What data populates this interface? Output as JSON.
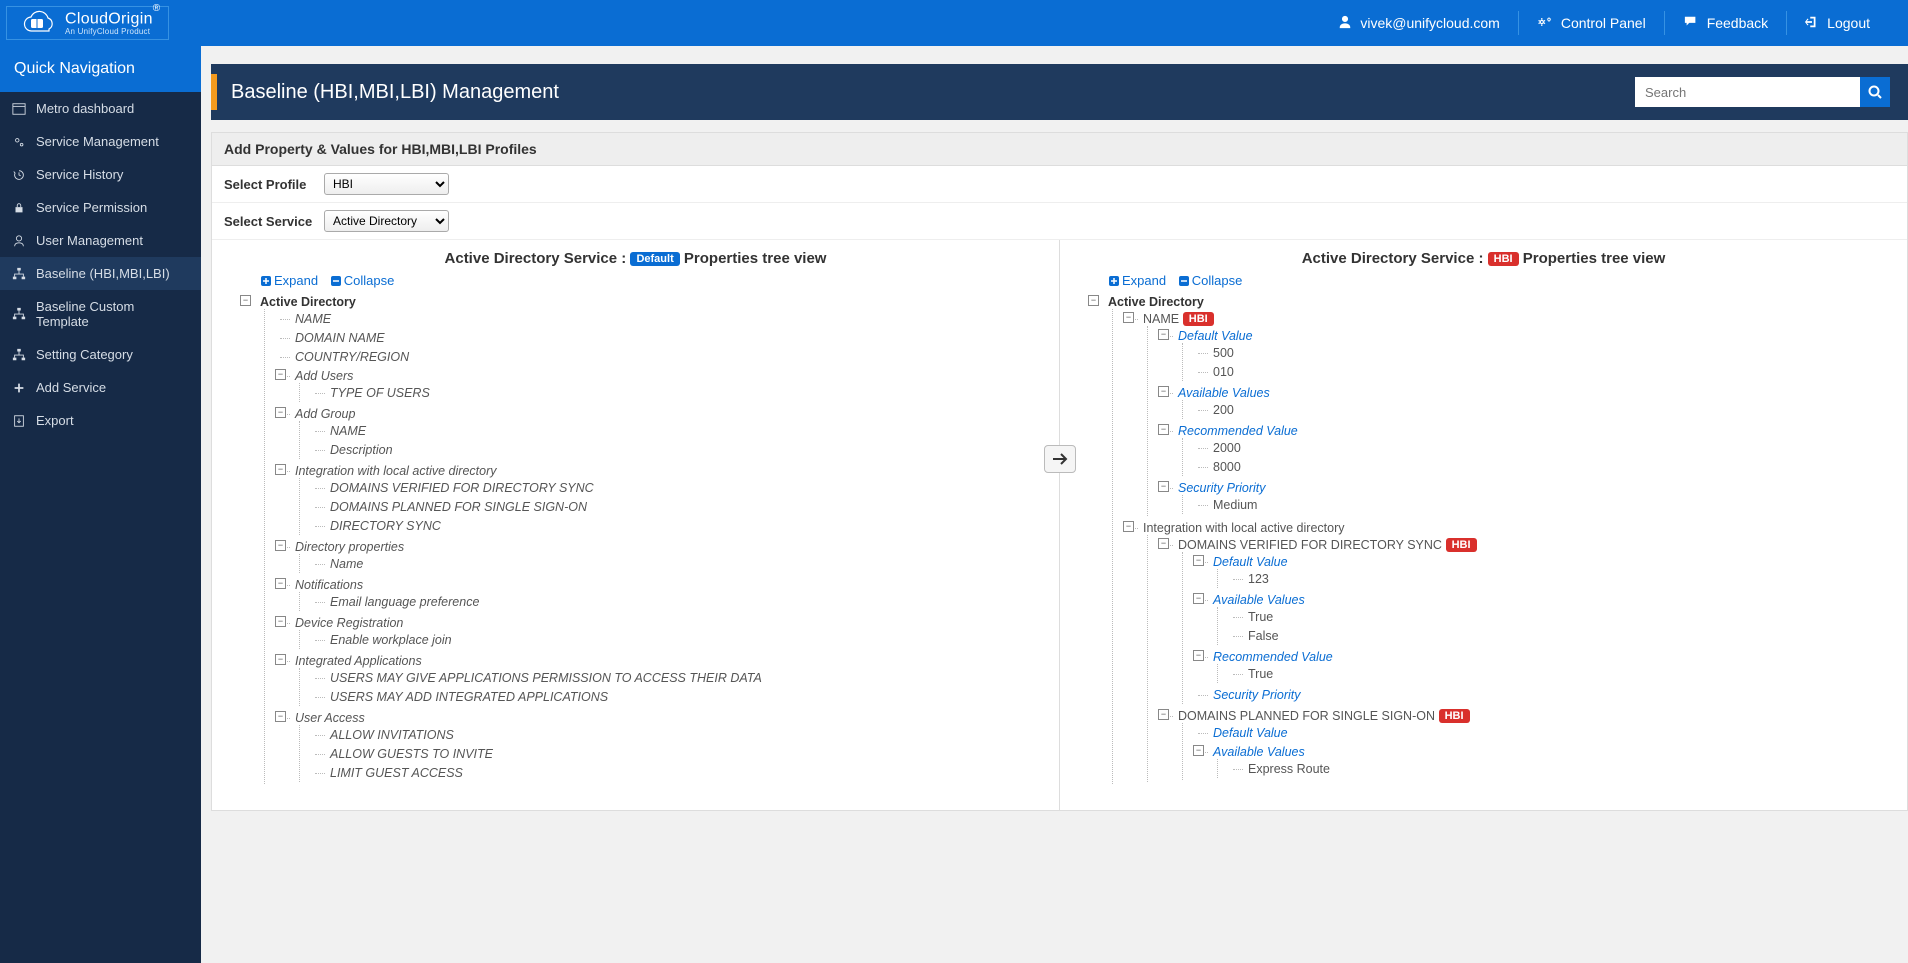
{
  "brand": {
    "name": "CloudOrigin",
    "sub": "An UnifyCloud Product"
  },
  "top": {
    "user": "vivek@unifycloud.com",
    "control_panel": "Control Panel",
    "feedback": "Feedback",
    "logout": "Logout"
  },
  "sidebar": {
    "head": "Quick Navigation",
    "items": [
      "Metro dashboard",
      "Service Management",
      "Service History",
      "Service Permission",
      "User Management",
      "Baseline (HBI,MBI,LBI)",
      "Baseline Custom Template",
      "Setting Category",
      "Add Service",
      "Export"
    ]
  },
  "page_title": "Baseline (HBI,MBI,LBI) Management",
  "search_placeholder": "Search",
  "panel_head": "Add Property & Values for HBI,MBI,LBI Profiles",
  "form": {
    "profile_label": "Select Profile",
    "profile_value": "HBI",
    "service_label": "Select Service",
    "service_value": "Active Directory"
  },
  "tree_actions": {
    "expand": "Expand",
    "collapse": "Collapse"
  },
  "left_tree": {
    "title_prefix": "Active Directory Service : ",
    "badge": "Default",
    "title_suffix": " Properties tree view",
    "root": "Active Directory",
    "nodes": {
      "name": "NAME",
      "domain_name": "DOMAIN NAME",
      "country": "COUNTRY/REGION",
      "add_users": "Add Users",
      "type_users": "TYPE OF USERS",
      "add_group": "Add Group",
      "grp_name": "NAME",
      "grp_desc": "Description",
      "integration": "Integration with local active directory",
      "dv_sync": "DOMAINS VERIFIED FOR DIRECTORY SYNC",
      "dp_sso": "DOMAINS PLANNED FOR SINGLE SIGN-ON",
      "dir_sync": "DIRECTORY SYNC",
      "dir_props": "Directory properties",
      "dp_name": "Name",
      "notif": "Notifications",
      "email_pref": "Email language preference",
      "dev_reg": "Device Registration",
      "workplace": "Enable workplace join",
      "int_apps": "Integrated Applications",
      "users_perm": "USERS MAY GIVE APPLICATIONS PERMISSION TO ACCESS THEIR DATA",
      "users_add": "USERS MAY ADD INTEGRATED APPLICATIONS",
      "user_access": "User Access",
      "allow_inv": "ALLOW INVITATIONS",
      "allow_guests": "ALLOW GUESTS TO INVITE",
      "limit_guest": "LIMIT GUEST ACCESS"
    }
  },
  "right_tree": {
    "title_prefix": "Active Directory Service : ",
    "badge": "HBI",
    "title_suffix": " Properties tree view",
    "root": "Active Directory",
    "nodes": {
      "name": "NAME",
      "default_value": "Default Value",
      "v500": "500",
      "v010": "010",
      "avail_values": "Available Values",
      "v200": "200",
      "rec_value": "Recommended Value",
      "v2000": "2000",
      "v8000": "8000",
      "sec_prio": "Security Priority",
      "medium": "Medium",
      "integration": "Integration with local active directory",
      "dv_sync": "DOMAINS VERIFIED FOR DIRECTORY SYNC",
      "dv_def": "Default Value",
      "v123": "123",
      "dv_avail": "Available Values",
      "true": "True",
      "false": "False",
      "dv_rec": "Recommended Value",
      "true2": "True",
      "dv_sec": "Security Priority",
      "dp_sso": "DOMAINS PLANNED FOR SINGLE SIGN-ON",
      "sso_def": "Default Value",
      "sso_avail": "Available Values",
      "express": "Express Route"
    }
  }
}
